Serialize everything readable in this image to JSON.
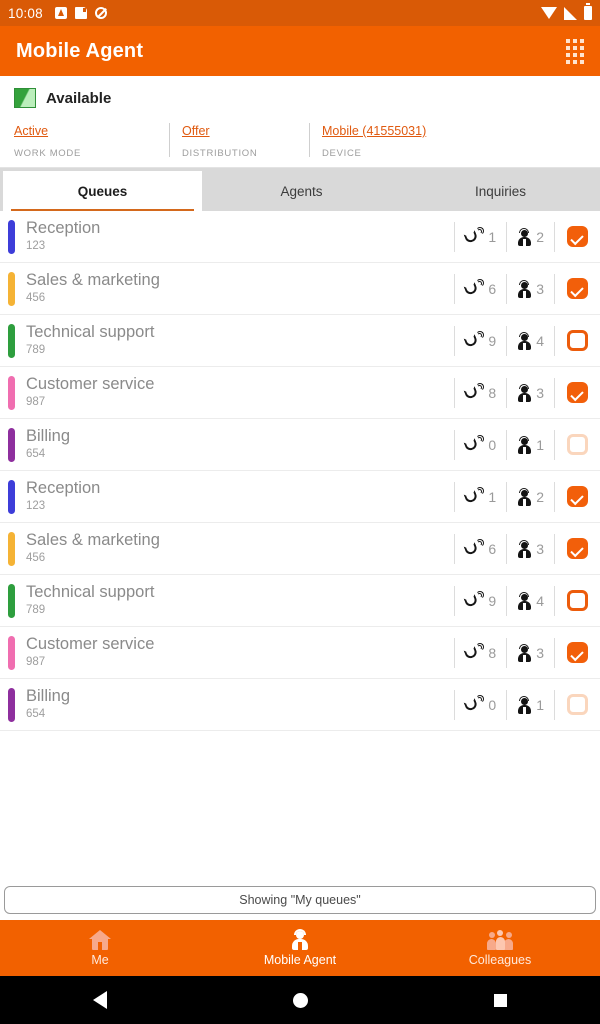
{
  "statusbar": {
    "time": "10:08",
    "left_icons": [
      "app-badge-icon",
      "sd-card-icon",
      "mute-icon"
    ],
    "right_icons": [
      "wifi-icon",
      "cell-signal-icon",
      "battery-icon"
    ]
  },
  "header": {
    "title": "Mobile Agent",
    "action_icon": "dialpad-icon",
    "background": "#f26100"
  },
  "presence": {
    "status_label": "Available",
    "status_icon": "available-split-square-icon",
    "status_color": "#34a23c",
    "meta": [
      {
        "value": "Active",
        "label": "WORK MODE"
      },
      {
        "value": "Offer",
        "label": "DISTRIBUTION"
      },
      {
        "value": "Mobile (41555031)",
        "label": "DEVICE"
      }
    ],
    "link_color": "#e05a10"
  },
  "tabs": [
    {
      "label": "Queues",
      "active": true
    },
    {
      "label": "Agents",
      "active": false
    },
    {
      "label": "Inquiries",
      "active": false
    }
  ],
  "queues": [
    {
      "name": "Reception",
      "number": "123",
      "color": "#3d3dd9",
      "calls": "1",
      "agents": "2",
      "status": "checked"
    },
    {
      "name": "Sales & marketing",
      "number": "456",
      "color": "#f5b335",
      "calls": "6",
      "agents": "3",
      "status": "checked"
    },
    {
      "name": "Technical support",
      "number": "789",
      "color": "#2e9e3e",
      "calls": "9",
      "agents": "4",
      "status": "ring"
    },
    {
      "name": "Customer service",
      "number": "987",
      "color": "#f06eb0",
      "calls": "8",
      "agents": "3",
      "status": "checked"
    },
    {
      "name": "Billing",
      "number": "654",
      "color": "#8e2f9e",
      "calls": "0",
      "agents": "1",
      "status": "faded"
    },
    {
      "name": "Reception",
      "number": "123",
      "color": "#3d3dd9",
      "calls": "1",
      "agents": "2",
      "status": "checked"
    },
    {
      "name": "Sales & marketing",
      "number": "456",
      "color": "#f5b335",
      "calls": "6",
      "agents": "3",
      "status": "checked"
    },
    {
      "name": "Technical support",
      "number": "789",
      "color": "#2e9e3e",
      "calls": "9",
      "agents": "4",
      "status": "ring"
    },
    {
      "name": "Customer service",
      "number": "987",
      "color": "#f06eb0",
      "calls": "8",
      "agents": "3",
      "status": "checked"
    },
    {
      "name": "Billing",
      "number": "654",
      "color": "#8e2f9e",
      "calls": "0",
      "agents": "1",
      "status": "faded"
    }
  ],
  "footer": {
    "showing_label": "Showing \"My queues\""
  },
  "bottom_nav": [
    {
      "label": "Me",
      "icon": "home-icon",
      "active": false
    },
    {
      "label": "Mobile Agent",
      "icon": "agent-icon",
      "active": true
    },
    {
      "label": "Colleagues",
      "icon": "people-icon",
      "active": false
    }
  ],
  "android_nav": {
    "back": "back-triangle-icon",
    "home": "home-circle-icon",
    "recents": "recents-square-icon"
  }
}
